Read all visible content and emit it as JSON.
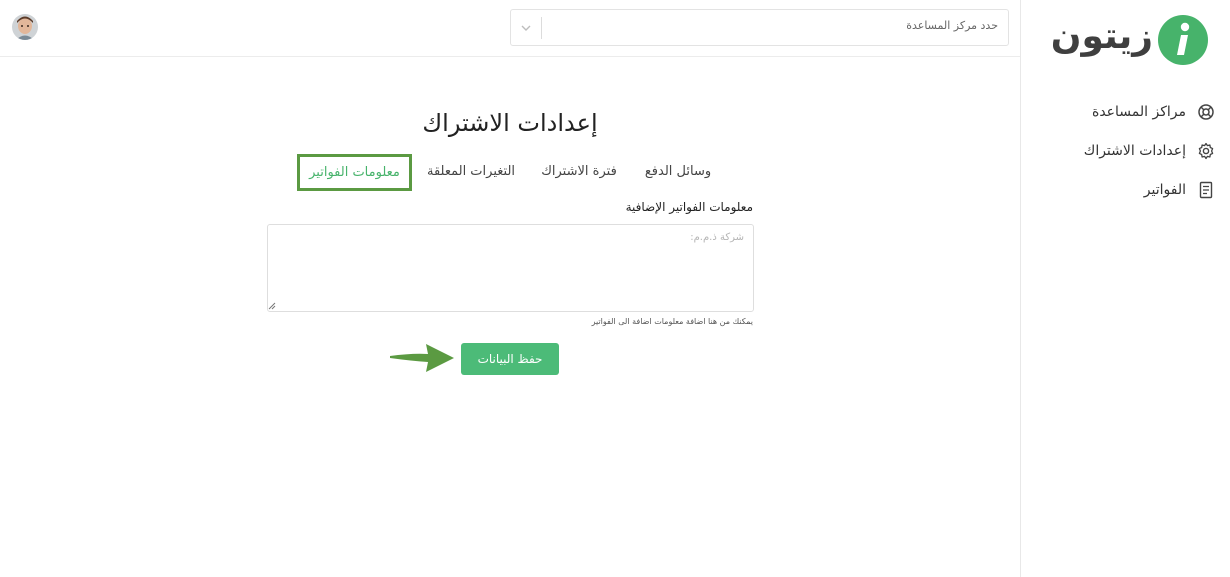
{
  "brand": {
    "logo_text": "زيتون",
    "logo_mark": "i",
    "color": "#47b36b"
  },
  "header": {
    "help_center_select": {
      "value": "حدد مركز المساعدة",
      "icon": "chevron-down-icon"
    },
    "avatar": "user-avatar"
  },
  "sidebar": {
    "items": [
      {
        "label": "مراكز المساعدة",
        "icon": "lifebuoy-icon"
      },
      {
        "label": "إعدادات الاشتراك",
        "icon": "gear-icon"
      },
      {
        "label": "الفواتير",
        "icon": "invoice-icon"
      }
    ]
  },
  "main": {
    "title": "إعدادات الاشتراك",
    "tabs": [
      {
        "label": "وسائل الدفع",
        "active": false
      },
      {
        "label": "فترة الاشتراك",
        "active": false
      },
      {
        "label": "التغيرات المعلقة",
        "active": false
      },
      {
        "label": "معلومات الفواتير",
        "active": true
      }
    ],
    "billing_info": {
      "label": "معلومات الفواتير الإضافية",
      "placeholder": "شركة ذ.م.م:",
      "value": "",
      "help": "يمكنك من هنا اضافة معلومات اضافة الى الفواتير"
    },
    "save_label": "حفظ البيانات"
  },
  "colors": {
    "accent": "#4cbb78",
    "highlight_border": "#5b9a42",
    "annotation_arrow": "#5b9a42"
  }
}
